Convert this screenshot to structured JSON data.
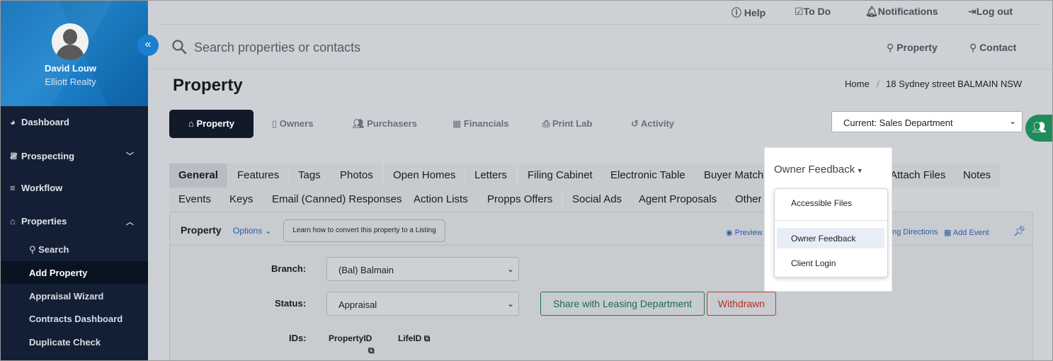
{
  "user": {
    "name": "David Louw",
    "company": "Elliott Realty"
  },
  "sidebar": {
    "collapse_icon": "«",
    "items": [
      {
        "label": "Dashboard",
        "icon": "dashboard-icon"
      },
      {
        "label": "Prospecting",
        "icon": "prospecting-icon"
      },
      {
        "label": "Workflow",
        "icon": "workflow-icon"
      },
      {
        "label": "Properties",
        "icon": "home-icon"
      }
    ],
    "subitems": [
      "Search",
      "Add Property",
      "Appraisal Wizard",
      "Contracts Dashboard",
      "Duplicate Check"
    ]
  },
  "topnav": {
    "help": "Help",
    "todo": "To Do",
    "notifications": "Notifications",
    "logout": "Log out"
  },
  "search": {
    "placeholder": "Search properties or contacts",
    "property": "Property",
    "contact": "Contact"
  },
  "page": {
    "title": "Property"
  },
  "breadcrumb": {
    "home": "Home",
    "sep": "/",
    "current": "18 Sydney street BALMAIN NSW"
  },
  "main_tabs": [
    "Property",
    "Owners",
    "Purchasers",
    "Financials",
    "Print Lab",
    "Activity"
  ],
  "department": {
    "selected": "Current: Sales Department"
  },
  "sub_tabs_row1": [
    "General",
    "Features",
    "Tags",
    "Photos",
    "Open Homes",
    "Letters",
    "Filing Cabinet",
    "Electronic Table",
    "Buyer Match",
    "Owner Feedback",
    "Attach Files",
    "Notes"
  ],
  "sub_tabs_row2": [
    "Events",
    "Keys",
    "Email (Canned) Responses",
    "Action Lists",
    "Propps Offers",
    "Social Ads",
    "Agent Proposals",
    "Other"
  ],
  "dropdown": {
    "items": [
      "Accessible Files",
      "Owner Feedback",
      "Client Login"
    ]
  },
  "panel": {
    "title": "Property",
    "options": "Options",
    "learn": "Learn how to convert this property to a Listing",
    "preview": "Preview Pr",
    "directions": "ng Directions",
    "add_event": "Add Event"
  },
  "form": {
    "branch_label": "Branch:",
    "branch_value": "(Bal) Balmain",
    "status_label": "Status:",
    "status_value": "Appraisal",
    "share_button": "Share with Leasing Department",
    "withdrawn_button": "Withdrawn",
    "ids_label": "IDs:",
    "property_id": "PropertyID",
    "life_id": "LifeID"
  },
  "colors": {
    "sidebar_bg": "#121f35",
    "profile_bg": "#1a7fd0",
    "active_tab": "#121a2a",
    "share_green": "#1d7a54",
    "withdraw_red": "#c0392b"
  }
}
